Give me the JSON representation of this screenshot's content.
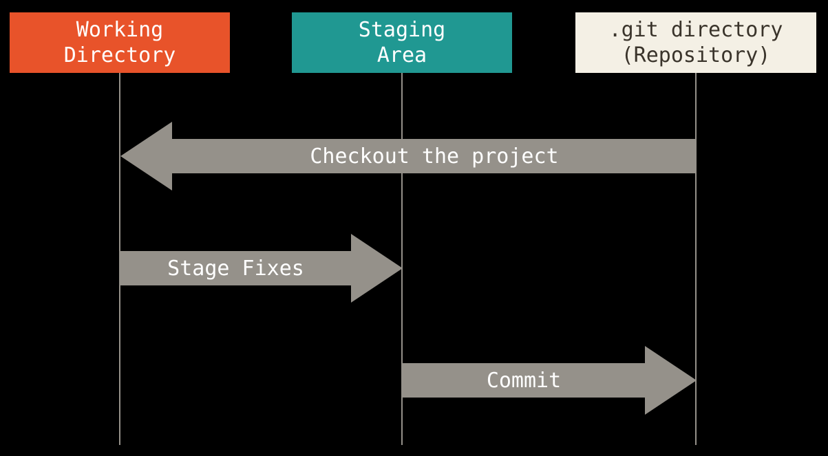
{
  "columns": {
    "working": {
      "line1": "Working",
      "line2": "Directory",
      "color": "#e8532a"
    },
    "staging": {
      "line1": "Staging",
      "line2": "Area",
      "color": "#209892"
    },
    "repo": {
      "line1": ".git directory",
      "line2": "(Repository)",
      "color": "#f4f0e5"
    }
  },
  "arrows": {
    "checkout": {
      "label": "Checkout the project",
      "from": "repo",
      "to": "working",
      "direction": "left"
    },
    "stage": {
      "label": "Stage Fixes",
      "from": "working",
      "to": "staging",
      "direction": "right"
    },
    "commit": {
      "label": "Commit",
      "from": "staging",
      "to": "repo",
      "direction": "right"
    }
  },
  "chart_data": {
    "type": "sequence-diagram",
    "participants": [
      {
        "id": "working",
        "label": "Working Directory"
      },
      {
        "id": "staging",
        "label": "Staging Area"
      },
      {
        "id": "repo",
        "label": ".git directory (Repository)"
      }
    ],
    "messages": [
      {
        "from": "repo",
        "to": "working",
        "label": "Checkout the project"
      },
      {
        "from": "working",
        "to": "staging",
        "label": "Stage Fixes"
      },
      {
        "from": "staging",
        "to": "repo",
        "label": "Commit"
      }
    ]
  }
}
